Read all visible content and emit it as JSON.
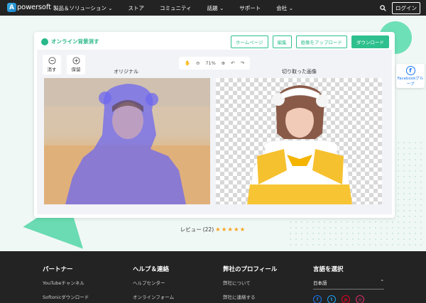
{
  "nav": {
    "logo_letter": "A",
    "logo_text": "powersoft",
    "items": [
      "製品＆ソリューション",
      "ストア",
      "コミュニティ",
      "話題",
      "サポート",
      "会社"
    ],
    "login": "ログイン"
  },
  "app": {
    "title": "オンライン背景消す",
    "buttons": [
      "ホームページ",
      "編集",
      "画像をアップロード",
      "ダウンロード"
    ],
    "tools": {
      "erase_label": "消す",
      "keep_label": "保留"
    },
    "zoom": "71%",
    "original_label": "オリジナル",
    "cutout_label": "切り取った画像"
  },
  "review": {
    "label": "レビュー",
    "count": "(22)",
    "stars": "★★★★★"
  },
  "facebook": {
    "letter": "f",
    "label": "Facebookグループ"
  },
  "footer": {
    "partner": {
      "title": "パートナー",
      "links": [
        "YouTubeチャンネル",
        "Softonicダウンロード"
      ]
    },
    "help": {
      "title": "ヘルプ＆連絡",
      "links": [
        "ヘルプセンター",
        "オンラインフォーム"
      ]
    },
    "profile": {
      "title": "弊社のプロフィール",
      "links": [
        "弊社について",
        "弊社に連絡する"
      ]
    },
    "language": {
      "title": "言語を選択",
      "selected": "日本語"
    }
  },
  "colors": {
    "accent": "#2ec08e",
    "nav_bg": "#232323",
    "star": "#f5a623",
    "brush": "#6e68f0"
  }
}
